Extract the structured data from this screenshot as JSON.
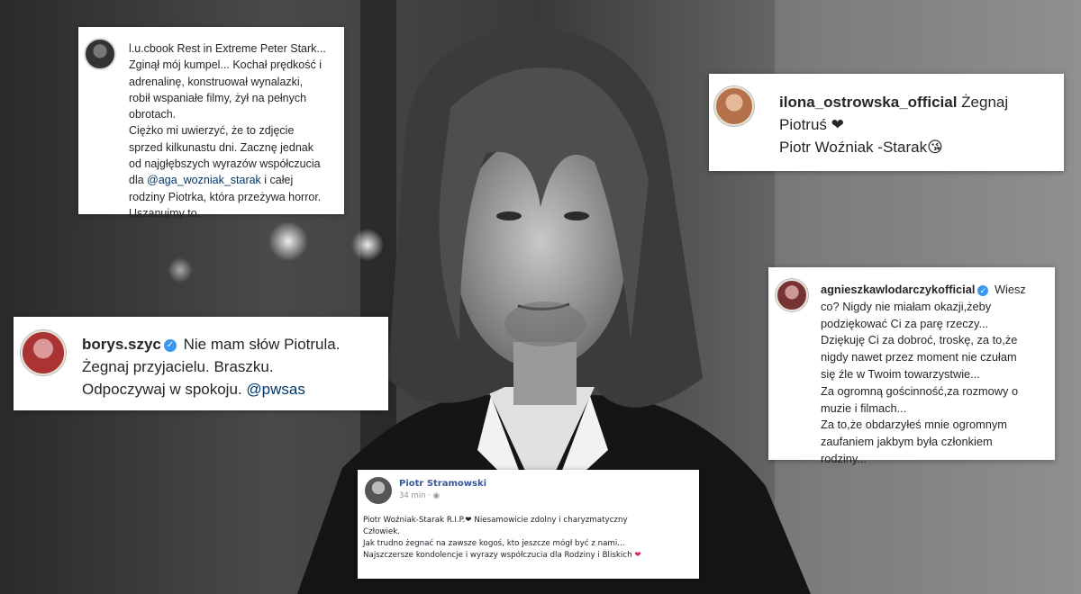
{
  "colors": {
    "instagram_link": "#00376b",
    "verified": "#3897f0",
    "facebook_name": "#385898",
    "red_heart": "#e0245e"
  },
  "card_lucbook": {
    "username": "l.u.cbook",
    "caption_start": " Rest in Extreme Peter Stark...",
    "lines": [
      "Zginął mój kumpel... Kochał prędkość i",
      "adrenalinę, konstruował wynalazki,",
      "robił wspaniałe filmy, żył na pełnych",
      "obrotach.",
      "Ciężko mi uwierzyć, że to zdjęcie",
      "sprzed kilkunastu dni. Zacznę jednak",
      "od najgłębszych wyrazów współczucia"
    ],
    "line8_prefix": "dla ",
    "mention": "@aga_wozniak_starak",
    "line8_suffix": " i całej",
    "line9": "rodziny Piotrka, która przeżywa horror.",
    "line10": "Uszanujmy to."
  },
  "card_ilona": {
    "username": "ilona_ostrowska_official",
    "text1": " Żegnaj",
    "text2": "Piotruś ",
    "text3": "Piotr Woźniak -Starak",
    "emoji": "😘"
  },
  "card_borys": {
    "username": "borys.szyc",
    "text1": " Nie mam słów Piotrula.",
    "line2": "Żegnaj przyjacielu. Braszku.",
    "line3": "Odpoczywaj w spokoju. ",
    "mention": "@pwsas"
  },
  "card_agnieszka": {
    "username": "agnieszkawlodarczykofficial",
    "first": " Wiesz",
    "lines": [
      "co? Nigdy nie miałam okazji,żeby",
      "podziękować Ci za parę rzeczy...",
      "Dziękuję Ci za dobroć, troskę, za to,że",
      "nigdy nawet przez moment nie czułam",
      "się źle w Twoim towarzystwie...",
      "Za ogromną gościnność,za rozmowy o",
      "muzie i filmach...",
      "Za to,że obdarzyłeś mnie ogromnym",
      "zaufaniem jakbym była członkiem",
      "rodziny..."
    ]
  },
  "card_piotr": {
    "name": "Piotr Stramowski",
    "time": "34 min",
    "dot": "·",
    "line1_a": "Piotr Woźniak-Starak R.I.P.",
    "line1_b": " Niesamowicie zdolny i charyzmatyczny",
    "line2": "Człowiek.",
    "line3": "Jak trudno żegnać na zawsze kogoś, kto jeszcze mógł być z nami...",
    "line4": "Najszczersze kondolencje i wyrazy współczucia dla Rodziny i Bliskich "
  }
}
